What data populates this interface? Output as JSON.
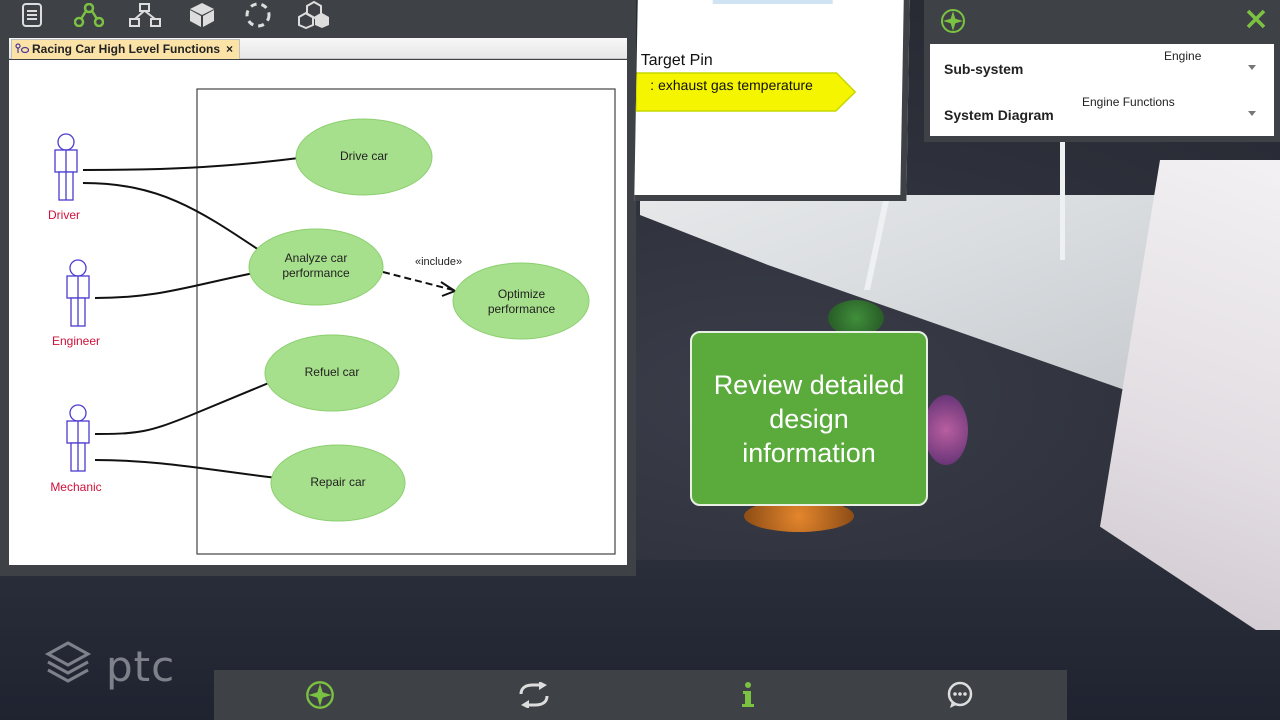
{
  "toolbar": {
    "icons": [
      "document-icon",
      "diagram-nodes-icon",
      "hierarchy-icon",
      "cube-icon",
      "selection-circle-icon",
      "hexagon-cluster-icon"
    ],
    "accent": "#7cc242"
  },
  "diagram": {
    "tab_title": "Racing Car High Level Functions",
    "tab_close": "×",
    "actors": [
      {
        "name": "Driver"
      },
      {
        "name": "Engineer"
      },
      {
        "name": "Mechanic"
      }
    ],
    "use_cases": [
      {
        "label": "Drive car"
      },
      {
        "label": "Analyze car performance"
      },
      {
        "label": "Optimize performance"
      },
      {
        "label": "Refuel car"
      },
      {
        "label": "Repair car"
      }
    ],
    "include_label": "«include»",
    "use_case_fill": "#a7e08c",
    "actor_color": "#d0103a"
  },
  "pin_panel": {
    "title": "Target Pin",
    "tag": ": exhaust gas temperature",
    "tag_color": "#f5f500"
  },
  "properties": {
    "rows": [
      {
        "label": "Sub-system",
        "value": "Engine"
      },
      {
        "label": "System Diagram",
        "value": "Engine Functions"
      }
    ],
    "close_color": "#7cc242"
  },
  "callout": {
    "text": "Review detailed design information",
    "color": "#5aaa3c"
  },
  "bottom_bar": {
    "buttons": [
      "target-logo-icon",
      "refresh-icon",
      "info-icon",
      "chat-icon"
    ]
  },
  "brand": {
    "name": "ptc"
  }
}
